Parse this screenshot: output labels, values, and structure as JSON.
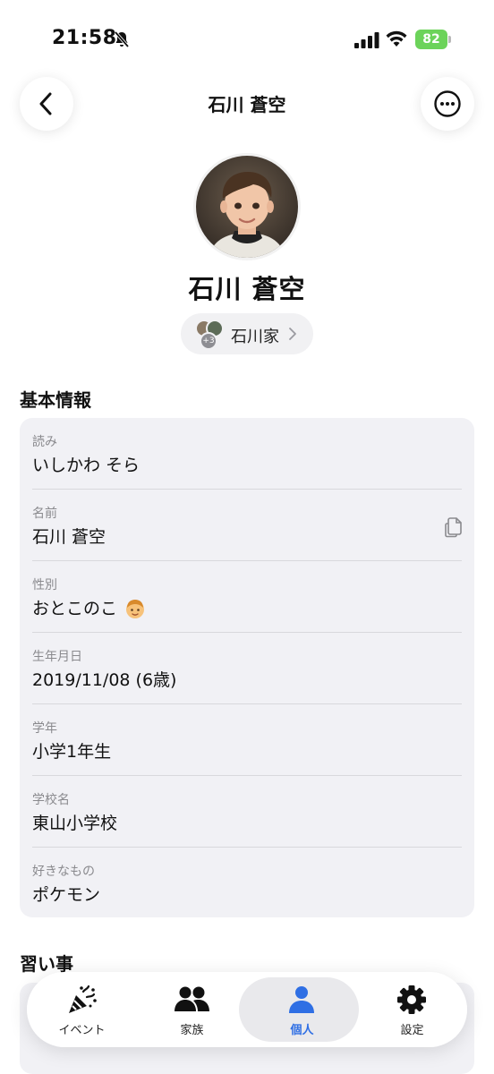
{
  "status_bar": {
    "time": "21:58",
    "battery": "82"
  },
  "header": {
    "title": "石川 蒼空"
  },
  "profile": {
    "name": "石川 蒼空",
    "family_label": "石川家",
    "family_extra_count": "+3"
  },
  "basic_info": {
    "section_title": "基本情報",
    "rows": [
      {
        "label": "読み",
        "value": "いしかわ そら"
      },
      {
        "label": "名前",
        "value": "石川 蒼空"
      },
      {
        "label": "性別",
        "value": "おとこのこ"
      },
      {
        "label": "生年月日",
        "value": "2019/11/08 (6歳)"
      },
      {
        "label": "学年",
        "value": "小学1年生"
      },
      {
        "label": "学校名",
        "value": "東山小学校"
      },
      {
        "label": "好きなもの",
        "value": "ポケモン"
      }
    ]
  },
  "lessons": {
    "section_title": "習い事"
  },
  "tab_bar": {
    "tabs": [
      {
        "label": "イベント",
        "icon": "party-popper-icon"
      },
      {
        "label": "家族",
        "icon": "people-icon"
      },
      {
        "label": "個人",
        "icon": "person-icon"
      },
      {
        "label": "設定",
        "icon": "gear-icon"
      }
    ],
    "active_tab": "個人",
    "active_color": "#2f6fe4"
  }
}
